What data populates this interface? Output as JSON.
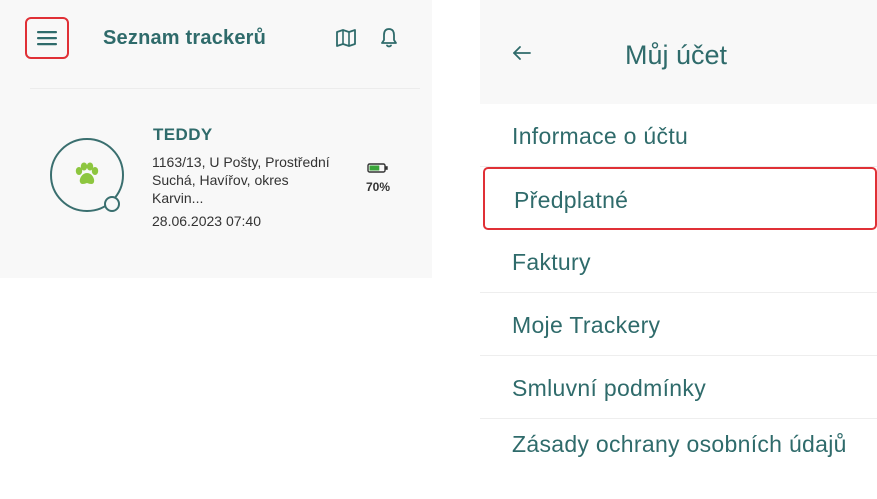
{
  "left": {
    "header": {
      "title": "Seznam trackerů",
      "menu_icon": "hamburger-menu-icon",
      "map_icon": "map-icon",
      "bell_icon": "bell-icon"
    },
    "tracker": {
      "name": "TEDDY",
      "address": "1163/13, U Pošty, Prostřední Suchá, Havířov, okres Karvin...",
      "datetime": "28.06.2023 07:40",
      "battery_percent": "70%",
      "battery_level": 0.7,
      "avatar_icon": "paw-icon",
      "accent_color": "#8dc63f"
    }
  },
  "right": {
    "header": {
      "title": "Můj účet",
      "back_icon": "back-arrow-icon"
    },
    "items": [
      {
        "label": "Informace o účtu"
      },
      {
        "label": "Předplatné"
      },
      {
        "label": "Faktury"
      },
      {
        "label": "Moje Trackery"
      },
      {
        "label": "Smluvní podmínky"
      },
      {
        "label": "Zásady ochrany osobních údajů"
      }
    ]
  },
  "colors": {
    "primary": "#2f6b6b",
    "highlight": "#e03036",
    "paw": "#8dc63f"
  }
}
